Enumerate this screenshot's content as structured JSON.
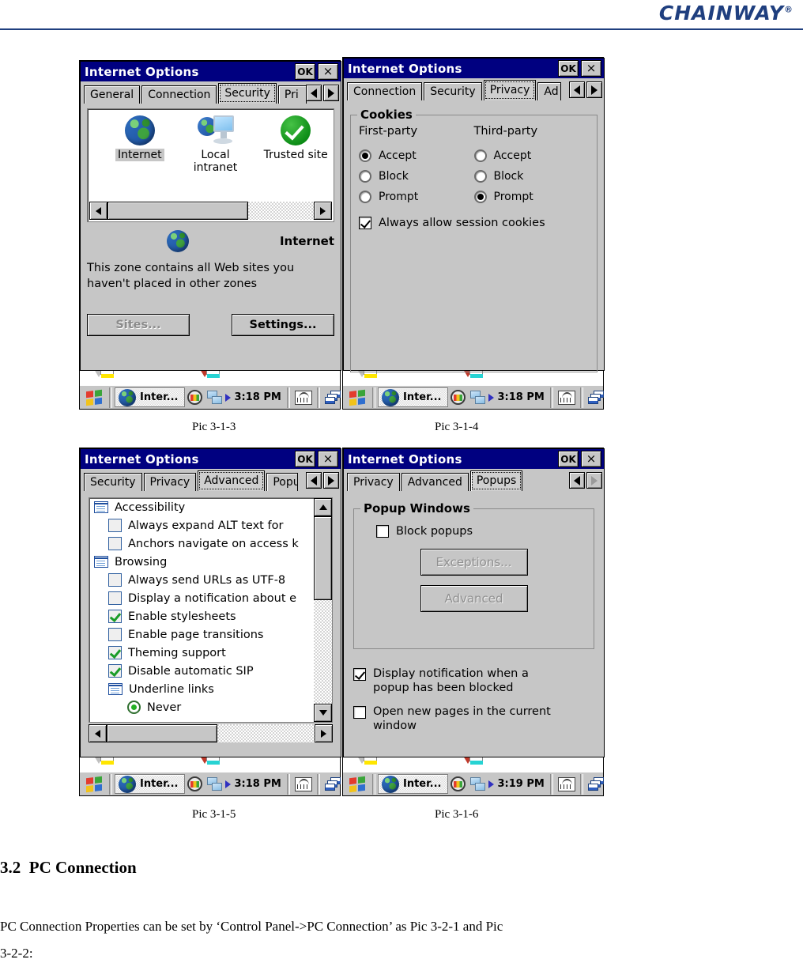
{
  "header": {
    "brand": "CHAINWAY",
    "registered": "®"
  },
  "common": {
    "window_title": "Internet Options",
    "ok_label": "OK",
    "close_label": "×",
    "taskbar": {
      "task_label": "Inter...",
      "start_icon": "windows-flag-icon",
      "tray_icons": [
        "palette-icon",
        "network-icon",
        "keyboard-icon",
        "desktop-icon"
      ]
    }
  },
  "pic_3_1_3": {
    "caption": "Pic 3-1-3",
    "title": "Internet Options",
    "tabs": [
      {
        "label": "General",
        "selected": false
      },
      {
        "label": "Connection",
        "selected": false
      },
      {
        "label": "Security",
        "selected": true
      },
      {
        "label": "Pri",
        "selected": false,
        "clipped": true
      }
    ],
    "zones": [
      {
        "label": "Internet",
        "icon": "globe-icon",
        "selected": true
      },
      {
        "label": "Local intranet",
        "icon": "intranet-icon",
        "selected": false
      },
      {
        "label": "Trusted site",
        "icon": "check-circle-icon",
        "selected": false
      }
    ],
    "selected_zone_name": "Internet",
    "zone_description": "This zone contains all Web sites you haven't placed in other zones",
    "buttons": [
      {
        "label": "Sites...",
        "disabled": true
      },
      {
        "label": "Settings...",
        "disabled": false
      }
    ],
    "clock": "3:18 PM"
  },
  "pic_3_1_4": {
    "caption": "Pic 3-1-4",
    "title": "Internet Options",
    "tabs": [
      {
        "label": "Connection",
        "selected": false
      },
      {
        "label": "Security",
        "selected": false
      },
      {
        "label": "Privacy",
        "selected": true
      },
      {
        "label": "Ad",
        "selected": false,
        "clipped": true
      }
    ],
    "group_title": "Cookies",
    "columns": [
      {
        "head": "First-party",
        "options": [
          {
            "label": "Accept",
            "selected": true
          },
          {
            "label": "Block",
            "selected": false
          },
          {
            "label": "Prompt",
            "selected": false
          }
        ]
      },
      {
        "head": "Third-party",
        "options": [
          {
            "label": "Accept",
            "selected": false
          },
          {
            "label": "Block",
            "selected": false
          },
          {
            "label": "Prompt",
            "selected": true
          }
        ]
      }
    ],
    "session_checkbox": {
      "label": "Always allow session cookies",
      "checked": true
    },
    "clock": "3:18 PM"
  },
  "pic_3_1_5": {
    "caption": "Pic 3-1-5",
    "title": "Internet Options",
    "tabs": [
      {
        "label": "Security",
        "selected": false
      },
      {
        "label": "Privacy",
        "selected": false
      },
      {
        "label": "Advanced",
        "selected": true
      },
      {
        "label": "Popu",
        "selected": false,
        "clipped": true
      }
    ],
    "list": [
      {
        "type": "group",
        "label": "Accessibility",
        "indent": 0
      },
      {
        "type": "checkbox",
        "label": "Always expand ALT text for",
        "checked": false,
        "indent": 1
      },
      {
        "type": "checkbox",
        "label": "Anchors navigate on access k",
        "checked": false,
        "indent": 1
      },
      {
        "type": "group",
        "label": "Browsing",
        "indent": 0
      },
      {
        "type": "checkbox",
        "label": "Always send URLs as UTF-8",
        "checked": false,
        "indent": 1
      },
      {
        "type": "checkbox",
        "label": "Display a notification about e",
        "checked": false,
        "indent": 1
      },
      {
        "type": "checkbox",
        "label": "Enable stylesheets",
        "checked": true,
        "indent": 1
      },
      {
        "type": "checkbox",
        "label": "Enable page transitions",
        "checked": false,
        "indent": 1
      },
      {
        "type": "checkbox",
        "label": "Theming support",
        "checked": true,
        "indent": 1
      },
      {
        "type": "checkbox",
        "label": "Disable automatic SIP",
        "checked": true,
        "indent": 1
      },
      {
        "type": "group",
        "label": "Underline links",
        "indent": 1
      },
      {
        "type": "radio",
        "label": "Never",
        "checked": true,
        "indent": 2
      }
    ],
    "clock": "3:18 PM"
  },
  "pic_3_1_6": {
    "caption": "Pic 3-1-6",
    "title": "Internet Options",
    "tabs": [
      {
        "label": "Privacy",
        "selected": false
      },
      {
        "label": "Advanced",
        "selected": false
      },
      {
        "label": "Popups",
        "selected": true
      }
    ],
    "group_title": "Popup Windows",
    "block_popups": {
      "label": "Block popups",
      "checked": false
    },
    "buttons": [
      {
        "label": "Exceptions...",
        "disabled": true
      },
      {
        "label": "Advanced",
        "disabled": true
      }
    ],
    "checkboxes": [
      {
        "label": "Display notification when a popup has been blocked",
        "checked": true
      },
      {
        "label": "Open new pages in the current window",
        "checked": false
      }
    ],
    "clock": "3:19 PM"
  },
  "document": {
    "section_number": "3.2",
    "section_title": "PC Connection",
    "body_line1": "PC Connection Properties can be set by ‘Control Panel->PC Connection’ as Pic 3-2-1 and Pic",
    "body_line2": "3-2-2:"
  }
}
